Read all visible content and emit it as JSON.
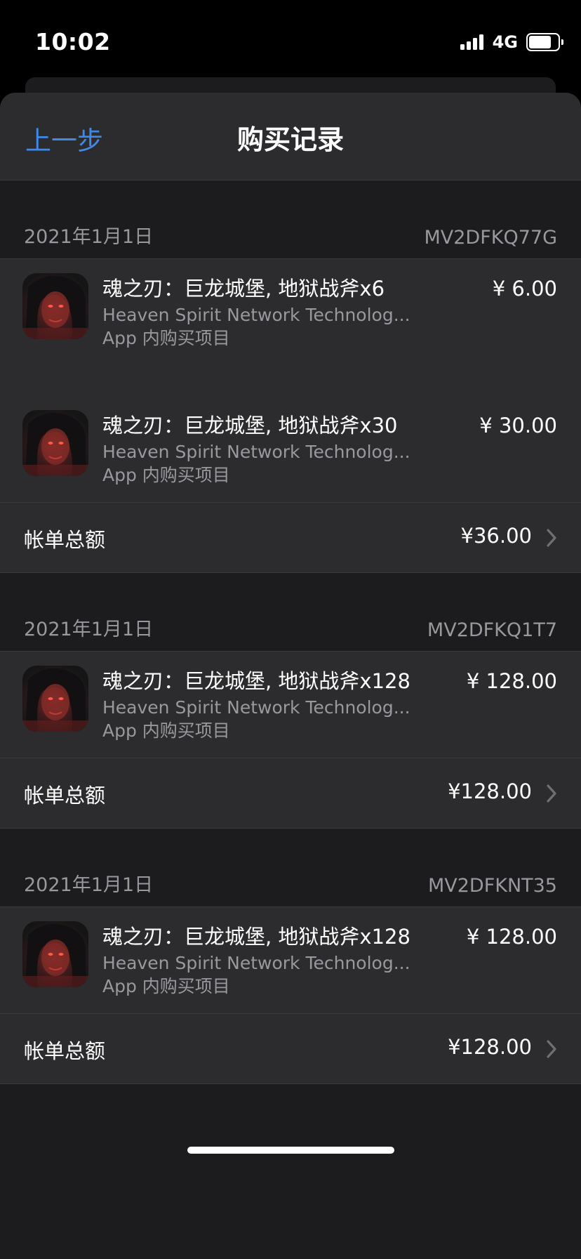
{
  "status_bar": {
    "time": "10:02",
    "network": "4G"
  },
  "nav": {
    "back_label": "上一步",
    "title": "购买记录"
  },
  "sections": [
    {
      "date": "2021年1月1日",
      "order_id": "MV2DFKQ77G",
      "items": [
        {
          "name": "魂之刃：巨龙城堡, 地狱战斧x6",
          "developer": "Heaven Spirit Network Technolog...",
          "type": "App 内购买项目",
          "price": "¥ 6.00"
        },
        {
          "name": "魂之刃：巨龙城堡, 地狱战斧x30",
          "developer": "Heaven Spirit Network Technolog...",
          "type": "App 内购买项目",
          "price": "¥ 30.00"
        }
      ],
      "total_label": "帐单总额",
      "total": "¥36.00"
    },
    {
      "date": "2021年1月1日",
      "order_id": "MV2DFKQ1T7",
      "items": [
        {
          "name": "魂之刃：巨龙城堡, 地狱战斧x128",
          "developer": "Heaven Spirit Network Technolog...",
          "type": "App 内购买项目",
          "price": "¥ 128.00"
        }
      ],
      "total_label": "帐单总额",
      "total": "¥128.00"
    },
    {
      "date": "2021年1月1日",
      "order_id": "MV2DFKNT35",
      "items": [
        {
          "name": "魂之刃：巨龙城堡, 地狱战斧x128",
          "developer": "Heaven Spirit Network Technolog...",
          "type": "App 内购买项目",
          "price": "¥ 128.00"
        }
      ],
      "total_label": "帐单总额",
      "total": "¥128.00"
    }
  ],
  "icons": {
    "app": "game-app-icon",
    "chevron": "chevron-right-icon",
    "signal": "cellular-signal-icon",
    "battery": "battery-icon"
  },
  "colors": {
    "accent": "#3f8ae8",
    "background": "#1c1c1e",
    "cell": "#2c2c2e",
    "secondary_text": "#98989e"
  }
}
